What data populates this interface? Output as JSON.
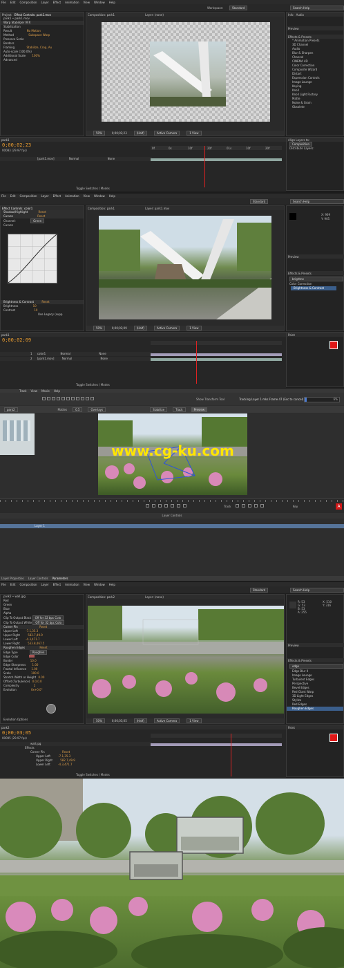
{
  "s1": {
    "menu": [
      "File",
      "Edit",
      "Composition",
      "Layer",
      "Effect",
      "Animation",
      "View",
      "Window",
      "Help"
    ],
    "project_tab": "Project",
    "effects_tab": "Effect Controls: park1.mov",
    "comp_tab": "Composition: park1",
    "layer_tab": "Layer: (none)",
    "workspace_label": "Workspace:",
    "workspace_value": "Standard",
    "search_placeholder": "Search Help",
    "breadcrumb": "park1 • park1.mov",
    "effect_name": "Warp Stabilizer VFX",
    "effect_rows": [
      "Stabilization",
      "Result",
      "Method",
      "Preserve Scale",
      "Borders",
      "Framing",
      "Auto-scale (100.0%)",
      "Additional Scale",
      "Advanced"
    ],
    "effect_values": [
      "",
      "No Motion",
      "Subspace Warp",
      "",
      "",
      "Stabilize, Crop, Au",
      "",
      "100%",
      ""
    ],
    "zoom": "50%",
    "timecode_small": "0;00;02;23",
    "res": "(Half)",
    "camera": "Active Camera",
    "view": "1 View",
    "right_tabs": [
      "Info",
      "Audio",
      "Preview",
      "Effects & Presets"
    ],
    "effects_list": [
      "* Animation Presets",
      "3D Channel",
      "Audio",
      "Blur & Sharpen",
      "Channel",
      "CINEMA 4D",
      "Color Correction",
      "Composite Wizard",
      "Distort",
      "Expression Controls",
      "Image Lounge",
      "Keying",
      "Knoll",
      "Knoll Light Factory",
      "Matte",
      "Noise & Grain",
      "Obsolete"
    ],
    "align_label": "Align Layers to:",
    "align_value": "Composition",
    "distribute_label": "Distribute Layers:",
    "timeline_tab": "park1",
    "timecode": "0;00;02;23",
    "frame_info": "00083 (29.97 fps)",
    "layer_name": "[park1.mov]",
    "layer_mode": "Normal",
    "layer_parent": "None",
    "ticks": [
      "0f",
      "0s",
      "10f",
      "20f",
      "01s",
      "10f",
      "20f"
    ],
    "toggle_label": "Toggle Switches / Modes"
  },
  "s2": {
    "effects_tab": "Effect Controls: color1",
    "comp_tab": "Composition: park1",
    "layer_tab": "Layer: park1.mov",
    "workspace_value": "Standard",
    "search_placeholder": "Search Help",
    "fx1": "Shadow/Highlight",
    "fx1_reset": "Reset",
    "fx2": "Curves",
    "fx2_reset": "Reset",
    "channel_label": "Channel:",
    "channel_value": "Green",
    "curves_label": "Curves",
    "fx3": "Brightness & Contrast",
    "fx3_reset": "Reset",
    "brightness_label": "Brightness",
    "brightness_value": "10",
    "contrast_label": "Contrast",
    "contrast_value": "10",
    "legacy_label": "Use Legacy (supp",
    "zoom": "50%",
    "timecode_small": "0;00;02;09",
    "res": "(Half)",
    "camera": "Active Camera",
    "view": "1 View",
    "info_x": "X: 969",
    "info_y": "Y: 905",
    "preview_tab": "Preview",
    "effects_presets_tab": "Effects & Presets",
    "search_value": "brightne",
    "category": "Color Correction",
    "result_item": "Brightness & Contrast",
    "timeline_tab": "park1",
    "timecode": "0;00;02;09",
    "layers": [
      {
        "num": "1",
        "name": "color1",
        "mode": "Normal",
        "parent": "None"
      },
      {
        "num": "2",
        "name": "[park1.mov]",
        "mode": "Normal",
        "parent": "None"
      }
    ],
    "paint_tab": "Paint",
    "toggle_label": "Toggle Switches / Modes"
  },
  "s3": {
    "menu": [
      "Track",
      "View",
      "Movie",
      "Help"
    ],
    "show_transform": "Show Transform Tool",
    "tracking_status": "Tracking Layer 1 mks Frame 47 (Esc to cancel)",
    "percent": "6%",
    "clip_label": "park2",
    "mattes_label": "Mattes",
    "opacity": "0.5",
    "overlays_label": "Overlays",
    "stabilize_label": "Stabilize",
    "track_label": "Track",
    "preview_label": "Preview",
    "watermark": "www.cg-ku.com",
    "track_btn": "Track",
    "key_btn": "Key",
    "layer_controls": "Layer Controls",
    "layer_name": "Layer 1",
    "bottom_tabs": [
      "Layer Properties",
      "Layer Controls",
      "Parameters"
    ]
  },
  "s4": {
    "menu": [
      "File",
      "Edit",
      "Composition",
      "Layer",
      "Effect",
      "Animation",
      "View",
      "Window",
      "Help"
    ],
    "comp_tab": "Composition: park2",
    "layer_tab": "Layer: (none)",
    "workspace_value": "Standard",
    "search_placeholder": "Search Help",
    "breadcrumb": "park2 • wall.jpg",
    "fx_rows": [
      "Red",
      "Green",
      "Blue",
      "Alpha",
      "Clip To Output Black",
      "Clip To Output White",
      "Corner Pin",
      "Upper Left",
      "Upper Right",
      "Lower Left",
      "Lower Right",
      "Roughen Edges",
      "Edge Type",
      "Edge Color",
      "Border",
      "Edge Sharpness",
      "Fractal Influence",
      "Scale",
      "Stretch Width or Height",
      "Offset (Turbulence)",
      "Complexity",
      "Evolution",
      "Evolution Options"
    ],
    "fx_values": [
      "",
      "",
      "",
      "",
      "Off for 32 bpc Colo",
      "Off for 32 bpc Colo",
      "Reset",
      "-7.1,35.3",
      "582.7,49.9",
      "-4.3,471.7",
      "533.8,467.5",
      "Reset",
      "Roughen",
      "",
      "10.0",
      "1.00",
      "1.00",
      "100.0",
      "0.00",
      "0.0,0.0",
      "2",
      "0x+0.0°",
      ""
    ],
    "info": [
      "R: 53",
      "G: 53",
      "B: 53",
      "A: 255",
      "X: 510",
      "Y: 316"
    ],
    "preview_tab": "Preview",
    "effects_tab": "Effects & Presets",
    "search_value": "edge",
    "effects_list": [
      "Edge Blur II",
      "Image Lounge",
      "Turbulent Edges",
      "Perspective",
      "Bevel Edges",
      "Red Giant Warp",
      "3D Light Edges",
      "Stylize",
      "Red Edges",
      "Roughen Edges"
    ],
    "zoom": "50%",
    "timecode_small": "0;00;03;05",
    "res": "(Half)",
    "camera": "Active Camera",
    "view": "1 View",
    "timeline_tab": "park2",
    "timecode": "0;00;03;05",
    "frame_info": "00095 (29.97 fps)",
    "tl_rows": [
      "Effects",
      "Corner Pin",
      "Upper Left",
      "Upper Right",
      "Lower Left"
    ],
    "tl_values": [
      "",
      "Reset",
      "-7.1,35.3",
      "582.7,49.9",
      "-4.3,471.7"
    ],
    "layer_name": "wall.jpg",
    "paint_tab": "Paint",
    "toggle_label": "Toggle Switches / Modes"
  }
}
